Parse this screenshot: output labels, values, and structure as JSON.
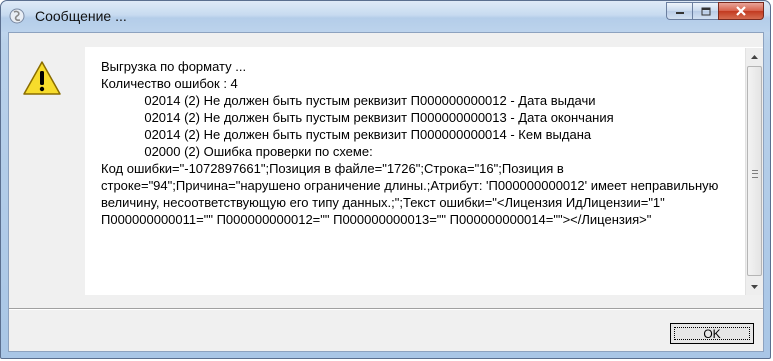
{
  "window": {
    "title": "Сообщение ...",
    "app_icon": "app-icon",
    "controls": {
      "minimize_icon": "minimize-icon",
      "maximize_icon": "maximize-icon",
      "close_icon": "close-icon"
    }
  },
  "dialog": {
    "icon": "warning-icon",
    "message": "Выгрузка по формату ...\nКоличество ошибок : 4\n            02014 (2) Не должен быть пустым реквизит П000000000012 - Дата выдачи\n            02014 (2) Не должен быть пустым реквизит П000000000013 - Дата окончания\n            02014 (2) Не должен быть пустым реквизит П000000000014 - Кем выдана\n            02000 (2) Ошибка проверки по схеме:\nКод ошибки=\"-1072897661\";Позиция в файле=\"1726\";Строка=\"16\";Позиция в строке=\"94\";Причина=\"нарушено ограничение длины.;Атрибут: 'П000000000012' имеет неправильную величину, несоответствующую его типу данных.;\";Текст ошибки=\"<Лицензия ИдЛицензии=\"1\" П000000000011=\"\" П000000000012=\"\" П000000000013=\"\" П000000000014=\"\"></Лицензия>\"",
    "ok_label": "OK"
  },
  "colors": {
    "title_bar": "#c7dbf0",
    "close_button": "#c23a20",
    "dialog_bg": "#f0f0f0"
  }
}
